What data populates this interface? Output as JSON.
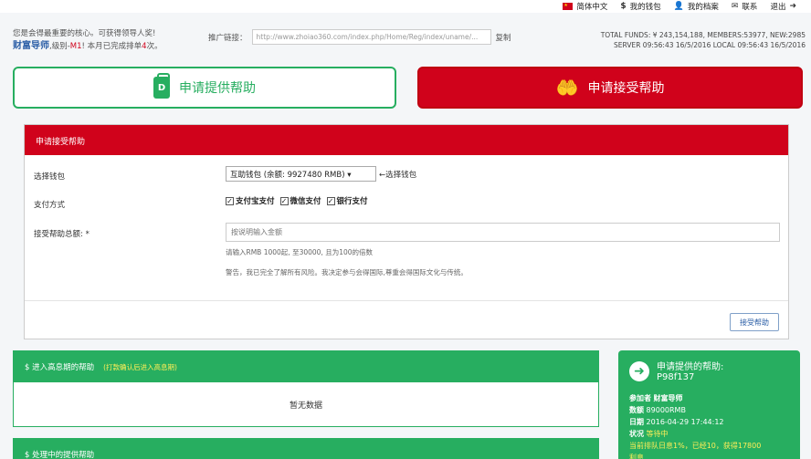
{
  "topnav": {
    "lang": "简体中文",
    "wallet": "我的钱包",
    "profile": "我的档案",
    "contact": "联系",
    "logout": "退出"
  },
  "header": {
    "line1": "您是会得最重要的核心。可获得领导人奖!",
    "username": "财富导师",
    "level_prefix": ",级别-",
    "level": "M1",
    "month_prefix": "! 本月已完成排单",
    "count": "4",
    "count_suffix": "次。",
    "promo_label": "推广链接：",
    "promo_url": "http://www.zhoiao360.com/index.php/Home/Reg/index/uname/...",
    "copy_label": "复制",
    "stats_line1": "TOTAL FUNDS: ¥ 243,154,188, MEMBERS:53977, NEW:2985",
    "stats_line2": "SERVER  09:56:43 16/5/2016  LOCAL  09:56:43 16/5/2016"
  },
  "actions": {
    "provide_label": "申请提供帮助",
    "accept_label": "申请接受帮助"
  },
  "form": {
    "title": "申请接受帮助",
    "wallet_label": "选择钱包",
    "wallet_selected": "互助钱包 (余额: 9927480 RMB)",
    "wallet_hint": "←选择钱包",
    "pay_label": "支付方式",
    "pay_options": [
      "支付宝支付",
      "微信支付",
      "银行支付"
    ],
    "amount_label": "接受帮助总额: *",
    "amount_placeholder": "按说明输入金额",
    "amount_hint": "请输入RMB 1000起, 至30000, 且为100的倍数",
    "warning": "警告，我已完全了解所有风险。我决定参与会得国际,尊重会得国际文化与传统。",
    "submit_label": "接受帮助"
  },
  "sections": {
    "interest_title": "$ 进入高息期的帮助",
    "interest_hint": "(打款确认后进入高息期)",
    "interest_empty": "暂无数据",
    "processing_title": "$ 处理中的提供帮助"
  },
  "side_card": {
    "title": "申请提供的帮助:",
    "code": "P98f137",
    "participant_label": "参加者",
    "participant": "财富导师",
    "amount_label": "数额",
    "amount": "89000RMB",
    "date_label": "日期",
    "date": "2016-04-29 17:44:12",
    "status_label": "状况",
    "status": "等待中",
    "note": "当前排队日息1%，已经10，获得17800",
    "note2": "利息"
  }
}
